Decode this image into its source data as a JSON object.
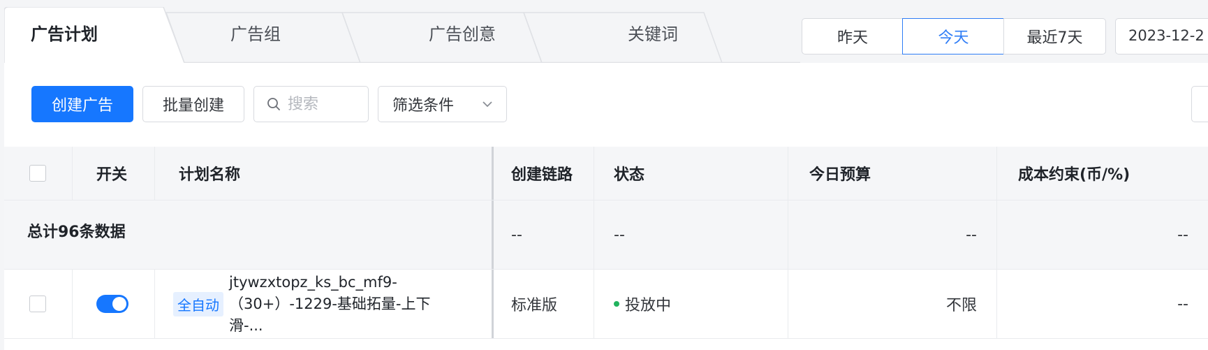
{
  "tabs": [
    {
      "label": "广告计划",
      "active": true
    },
    {
      "label": "广告组",
      "active": false
    },
    {
      "label": "广告创意",
      "active": false
    },
    {
      "label": "关键词",
      "active": false
    }
  ],
  "date_range": {
    "options": [
      "昨天",
      "今天",
      "最近7天"
    ],
    "selected": "今天",
    "date_value": "2023-12-2"
  },
  "toolbar": {
    "create_label": "创建广告",
    "batch_label": "批量创建",
    "search_placeholder": "搜索",
    "filter_label": "筛选条件"
  },
  "table": {
    "columns": {
      "switch": "开关",
      "plan_name": "计划名称",
      "create_link": "创建链路",
      "status": "状态",
      "budget": "今日预算",
      "cost_constraint": "成本约束(币/%)"
    },
    "total": {
      "label": "总计96条数据",
      "create_link": "--",
      "status": "--",
      "budget": "--",
      "cost_constraint": "--"
    },
    "rows": [
      {
        "tag": "全自动",
        "plan_name": "jtywzxtopz_ks_bc_mf9-（30+）-1229-基础拓量-上下滑-...",
        "create_link": "标准版",
        "status": "投放中",
        "budget": "不限",
        "cost_constraint": "--",
        "switch_on": true
      }
    ]
  },
  "colors": {
    "primary": "#1677ff",
    "status_active": "#22b35e"
  }
}
